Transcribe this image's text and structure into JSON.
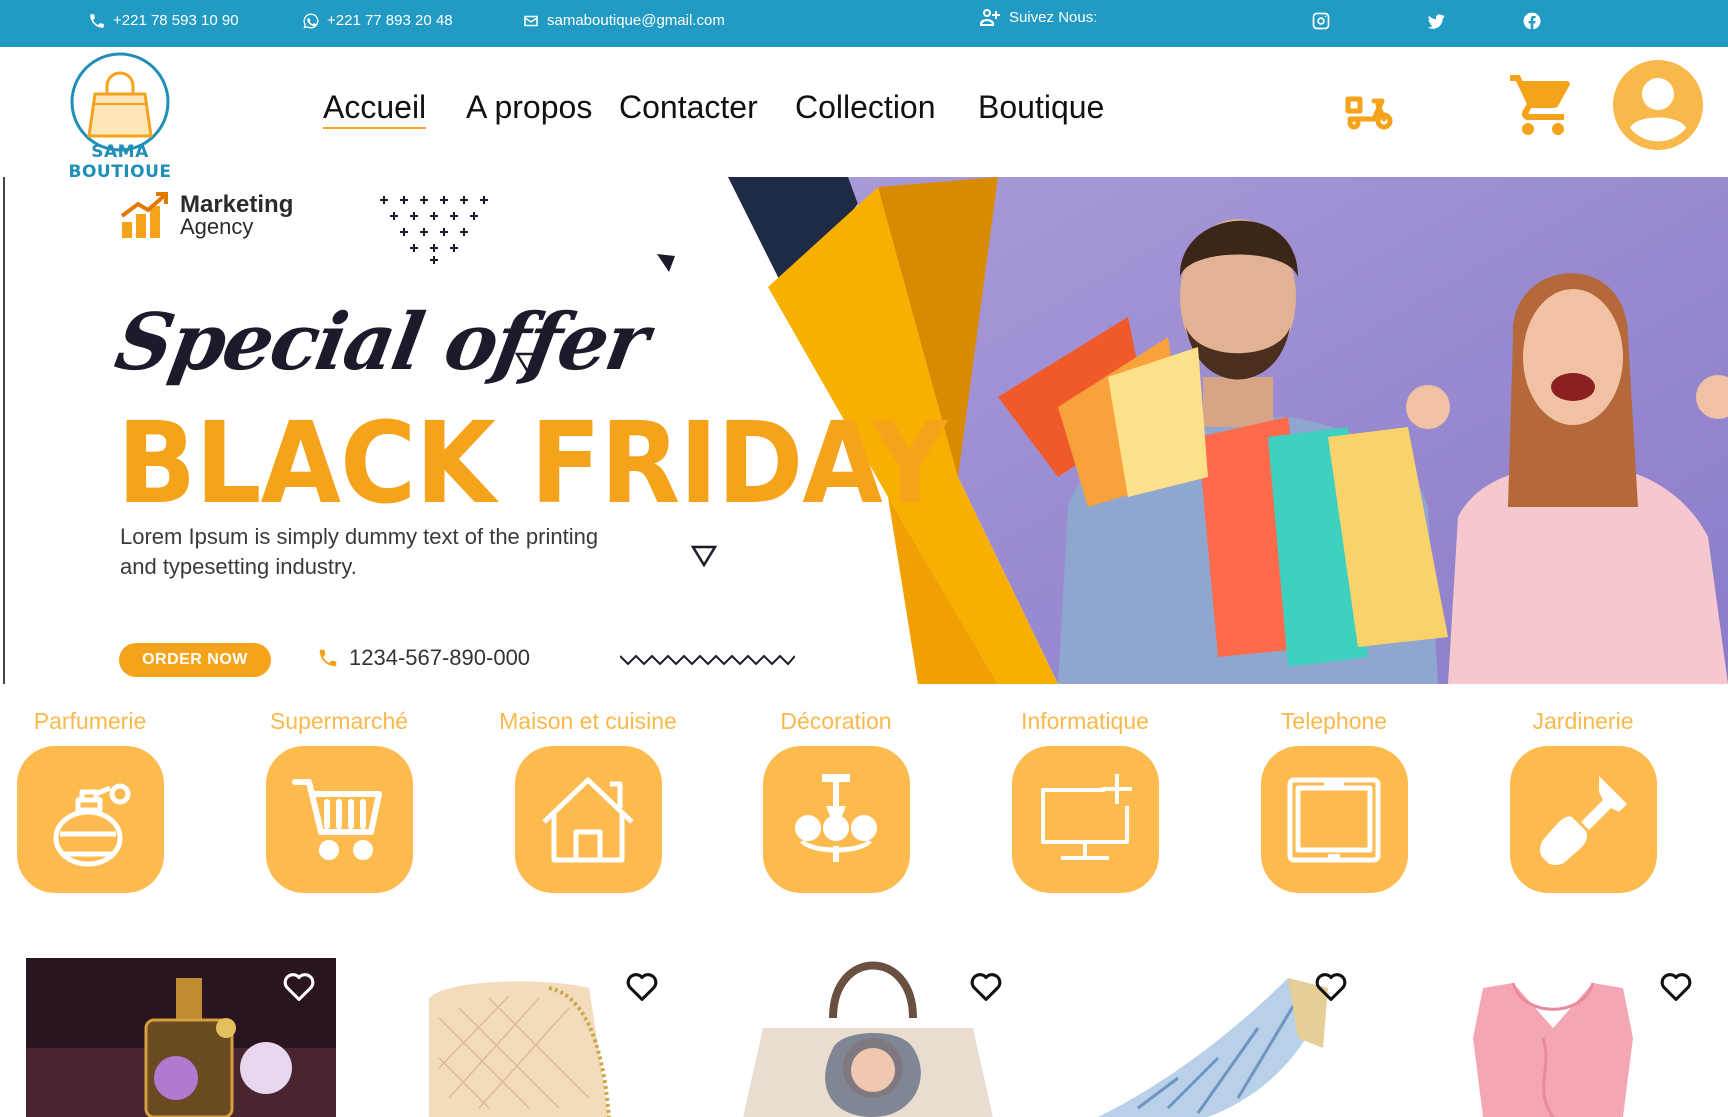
{
  "topbar": {
    "phone": "+221 78 593 10 90",
    "whatsapp": "+221 77 893 20 48",
    "email": "samaboutique@gmail.com",
    "follow_label": "Suivez Nous:",
    "social": [
      "instagram-icon",
      "twitter-icon",
      "facebook-icon"
    ]
  },
  "header": {
    "logo_text": "SAMA BOUTIQUE",
    "nav": [
      {
        "label": "Accueil",
        "active": true
      },
      {
        "label": "A propos"
      },
      {
        "label": "Contacter"
      },
      {
        "label": "Collection"
      },
      {
        "label": "Boutique"
      }
    ],
    "icons": [
      "delivery-scooter-icon",
      "cart-icon",
      "user-account-icon"
    ]
  },
  "banner": {
    "brand_name": "Marketing",
    "brand_sub": "Agency",
    "script_title": "Special offer",
    "headline": "BLACK FRIDAY",
    "body": "Lorem Ipsum is simply dummy text of the printing and typesetting industry.",
    "cta": "ORDER NOW",
    "phone": "1234-567-890-000"
  },
  "categories": [
    {
      "label": "Parfumerie",
      "icon": "perfume-icon"
    },
    {
      "label": "Supermarché",
      "icon": "cart-icon"
    },
    {
      "label": "Maison et cuisine",
      "icon": "house-icon"
    },
    {
      "label": "Décoration",
      "icon": "chandelier-icon"
    },
    {
      "label": "Informatique",
      "icon": "computer-icon"
    },
    {
      "label": "Telephone",
      "icon": "tablet-icon"
    },
    {
      "label": "Jardinerie",
      "icon": "shovel-icon"
    }
  ],
  "products": [
    {
      "name": "perfume-bottle"
    },
    {
      "name": "quilted-handbag"
    },
    {
      "name": "printed-tote-bag"
    },
    {
      "name": "striped-shoe"
    },
    {
      "name": "pink-blouse"
    }
  ],
  "colors": {
    "topbar_bg": "#219bc3",
    "accent": "#f5a31a",
    "category_bg": "#fdba4e",
    "category_text": "#f9b84a"
  }
}
